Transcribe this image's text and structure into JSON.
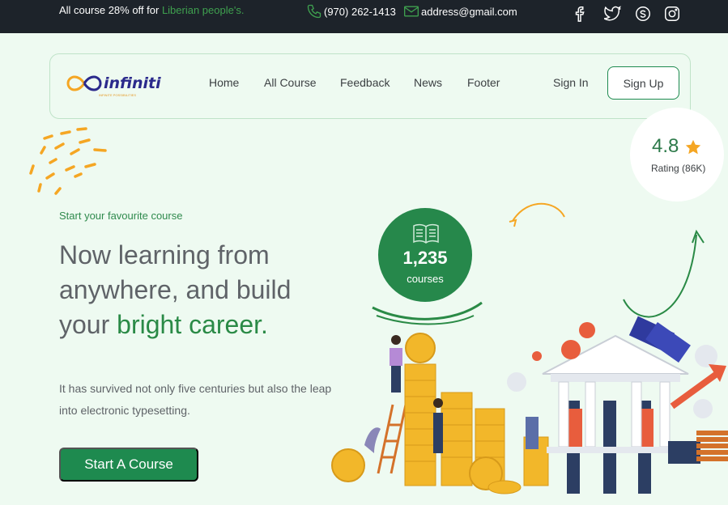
{
  "topbar": {
    "promo_prefix": "All course 28% off for ",
    "promo_highlight": "Liberian people's.",
    "phone": "(970) 262-1413",
    "email": "address@gmail.com",
    "social_icons": [
      "facebook-icon",
      "twitter-icon",
      "skype-icon",
      "instagram-icon"
    ]
  },
  "nav": {
    "logo_text": "infiniti",
    "logo_subtext": "INFINITE POSSIBILITIES",
    "items": [
      {
        "label": "Home"
      },
      {
        "label": "All Course"
      },
      {
        "label": "Feedback"
      },
      {
        "label": "News"
      },
      {
        "label": "Footer"
      }
    ],
    "signin_label": "Sign In",
    "signup_label": "Sign Up"
  },
  "rating": {
    "value": "4.8",
    "label": "Rating (86K)"
  },
  "hero": {
    "kicker": "Start your favourite course",
    "headline_part1": "Now learning from anywhere, and build your ",
    "headline_accent": "bright career.",
    "description": "It has survived not only five centuries but also the leap into electronic typesetting.",
    "cta_label": "Start A Course"
  },
  "courses_badge": {
    "count": "1,235",
    "unit": "courses"
  },
  "colors": {
    "primary": "#1e8a4f",
    "topbar_bg": "#1d232a",
    "page_bg": "#eefaf1",
    "accent_orange": "#f5a623"
  }
}
